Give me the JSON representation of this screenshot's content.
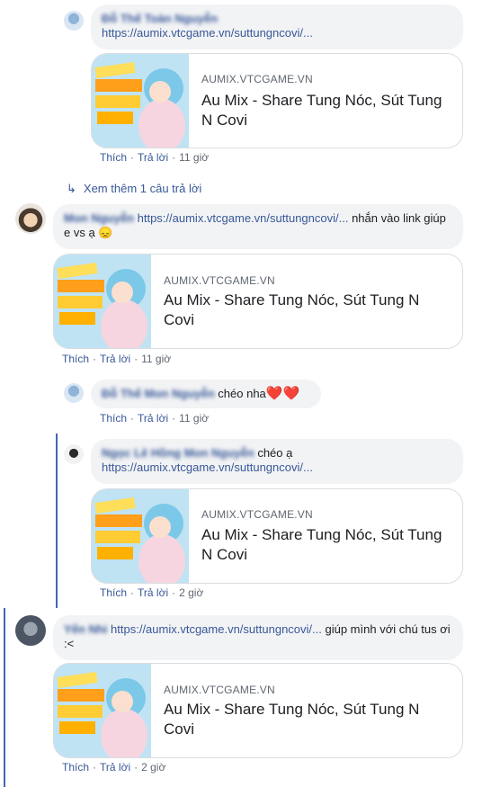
{
  "comments": [
    {
      "name": "Đỗ Thế Toàn Nguyễn",
      "link": "https://aumix.vtcgame.vn/suttungncovi/...",
      "text": "",
      "card": {
        "domain": "AUMIX.VTCGAME.VN",
        "title": "Au Mix - Share Tung Nóc, Sút Tung N Covi"
      },
      "actions": {
        "like": "Thích",
        "reply": "Trả lời",
        "time": "11 giờ"
      }
    },
    {
      "name": "Mon Nguyễn",
      "link": "https://aumix.vtcgame.vn/suttungncovi/...",
      "text_after": " nhắn vào link giúp e vs ạ",
      "emoji": "😞",
      "card": {
        "domain": "AUMIX.VTCGAME.VN",
        "title": "Au Mix - Share Tung Nóc, Sút Tung N Covi"
      },
      "actions": {
        "like": "Thích",
        "reply": "Trả lời",
        "time": "11 giờ"
      }
    },
    {
      "name": "Đỗ Thế Mon Nguyễn",
      "text": "chéo nha",
      "hearts": "❤️❤️",
      "actions": {
        "like": "Thích",
        "reply": "Trả lời",
        "time": "11 giờ"
      }
    },
    {
      "name": "Ngọc Lê Hồng Mon Nguyễn",
      "text": " chéo ạ",
      "link": "https://aumix.vtcgame.vn/suttungncovi/...",
      "card": {
        "domain": "AUMIX.VTCGAME.VN",
        "title": "Au Mix - Share Tung Nóc, Sút Tung N Covi"
      },
      "actions": {
        "like": "Thích",
        "reply": "Trả lời",
        "time": "2 giờ"
      }
    },
    {
      "name": "Yến Nhi",
      "link": "https://aumix.vtcgame.vn/suttungncovi/...",
      "text_after": " giúp mình với chú tus ơi :<",
      "card": {
        "domain": "AUMIX.VTCGAME.VN",
        "title": "Au Mix - Share Tung Nóc, Sút Tung N Covi"
      },
      "actions": {
        "like": "Thích",
        "reply": "Trả lời",
        "time": "2 giờ"
      }
    }
  ],
  "view_more": "Xem thêm 1 câu trả lời",
  "colors": {
    "link": "#385898",
    "bubble": "#f2f3f5",
    "thread": "#4267b2",
    "heart": "#e0245e"
  }
}
